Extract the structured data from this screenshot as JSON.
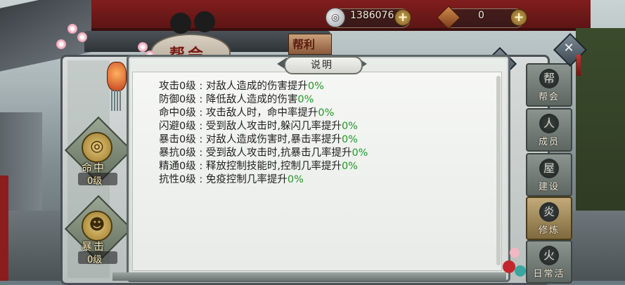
{
  "hud": {
    "coins": "1386076",
    "gems": "0"
  },
  "guild": {
    "title": "帮会",
    "sub_plaque": "帮利"
  },
  "skills": [
    {
      "name": "命中",
      "level": "0级"
    },
    {
      "name": "暴击",
      "level": "0级"
    }
  ],
  "side_tabs": [
    {
      "label": "帮会",
      "icon": "帮"
    },
    {
      "label": "成员",
      "icon": "人"
    },
    {
      "label": "建设",
      "icon": "屋"
    },
    {
      "label": "修炼",
      "icon": "炎"
    },
    {
      "label": "日常活",
      "icon": "火"
    }
  ],
  "dialog": {
    "title": "说明",
    "stats": [
      {
        "name": "攻击0级",
        "desc": "对敌人造成的伤害提升",
        "pct": "0%"
      },
      {
        "name": "防御0级",
        "desc": "降低敌人造成的伤害",
        "pct": "0%"
      },
      {
        "name": "命中0级",
        "desc": "攻击敌人时，命中率提升",
        "pct": "0%"
      },
      {
        "name": "闪避0级",
        "desc": "受到敌人攻击时,躲闪几率提升",
        "pct": "0%"
      },
      {
        "name": "暴击0级",
        "desc": "对敌人造成伤害时,暴击率提升",
        "pct": "0%"
      },
      {
        "name": "暴抗0级",
        "desc": "受到敌人攻击时,抗暴击几率提升",
        "pct": "0%"
      },
      {
        "name": "精通0级",
        "desc": "释放控制技能时,控制几率提升",
        "pct": "0%"
      },
      {
        "name": "抗性0级",
        "desc": "免疫控制几率提升",
        "pct": "0%"
      }
    ]
  },
  "colors": {
    "accent_green": "#1c9a22",
    "guild_red": "#7a1a12"
  }
}
